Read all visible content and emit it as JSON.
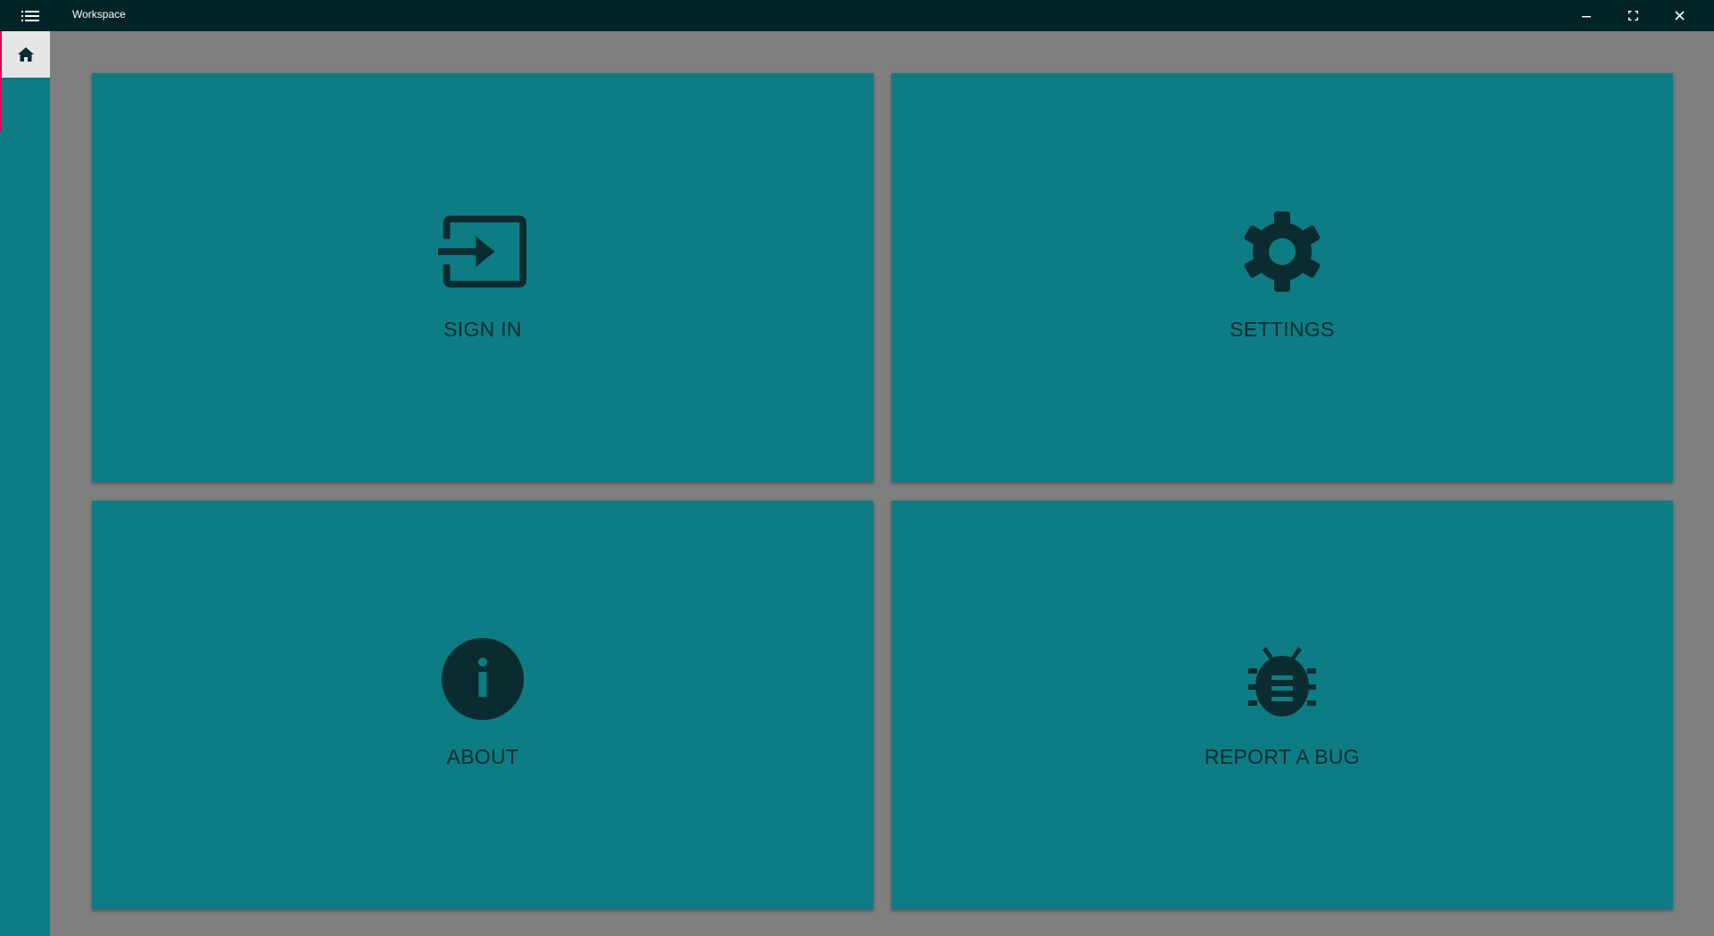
{
  "window": {
    "title": "Workspace",
    "menu_icon": "hamburger-list-icon",
    "controls": {
      "minimize_icon": "minimize-icon",
      "maximize_icon": "maximize-icon",
      "close_icon": "close-icon"
    }
  },
  "sidebar": {
    "items": [
      {
        "icon": "home-icon",
        "selected": true
      }
    ]
  },
  "tiles": [
    {
      "label": "SIGN IN",
      "icon": "sign-in-icon"
    },
    {
      "label": "SETTINGS",
      "icon": "gear-icon"
    },
    {
      "label": "ABOUT",
      "icon": "info-icon"
    },
    {
      "label": "REPORT A BUG",
      "icon": "bug-icon"
    }
  ],
  "colors": {
    "titlebar": "#002426",
    "accent": "#0e7c84",
    "background": "#7f7f7f",
    "icon_dark": "#0a2c30",
    "selection_marker": "#e0005a"
  }
}
